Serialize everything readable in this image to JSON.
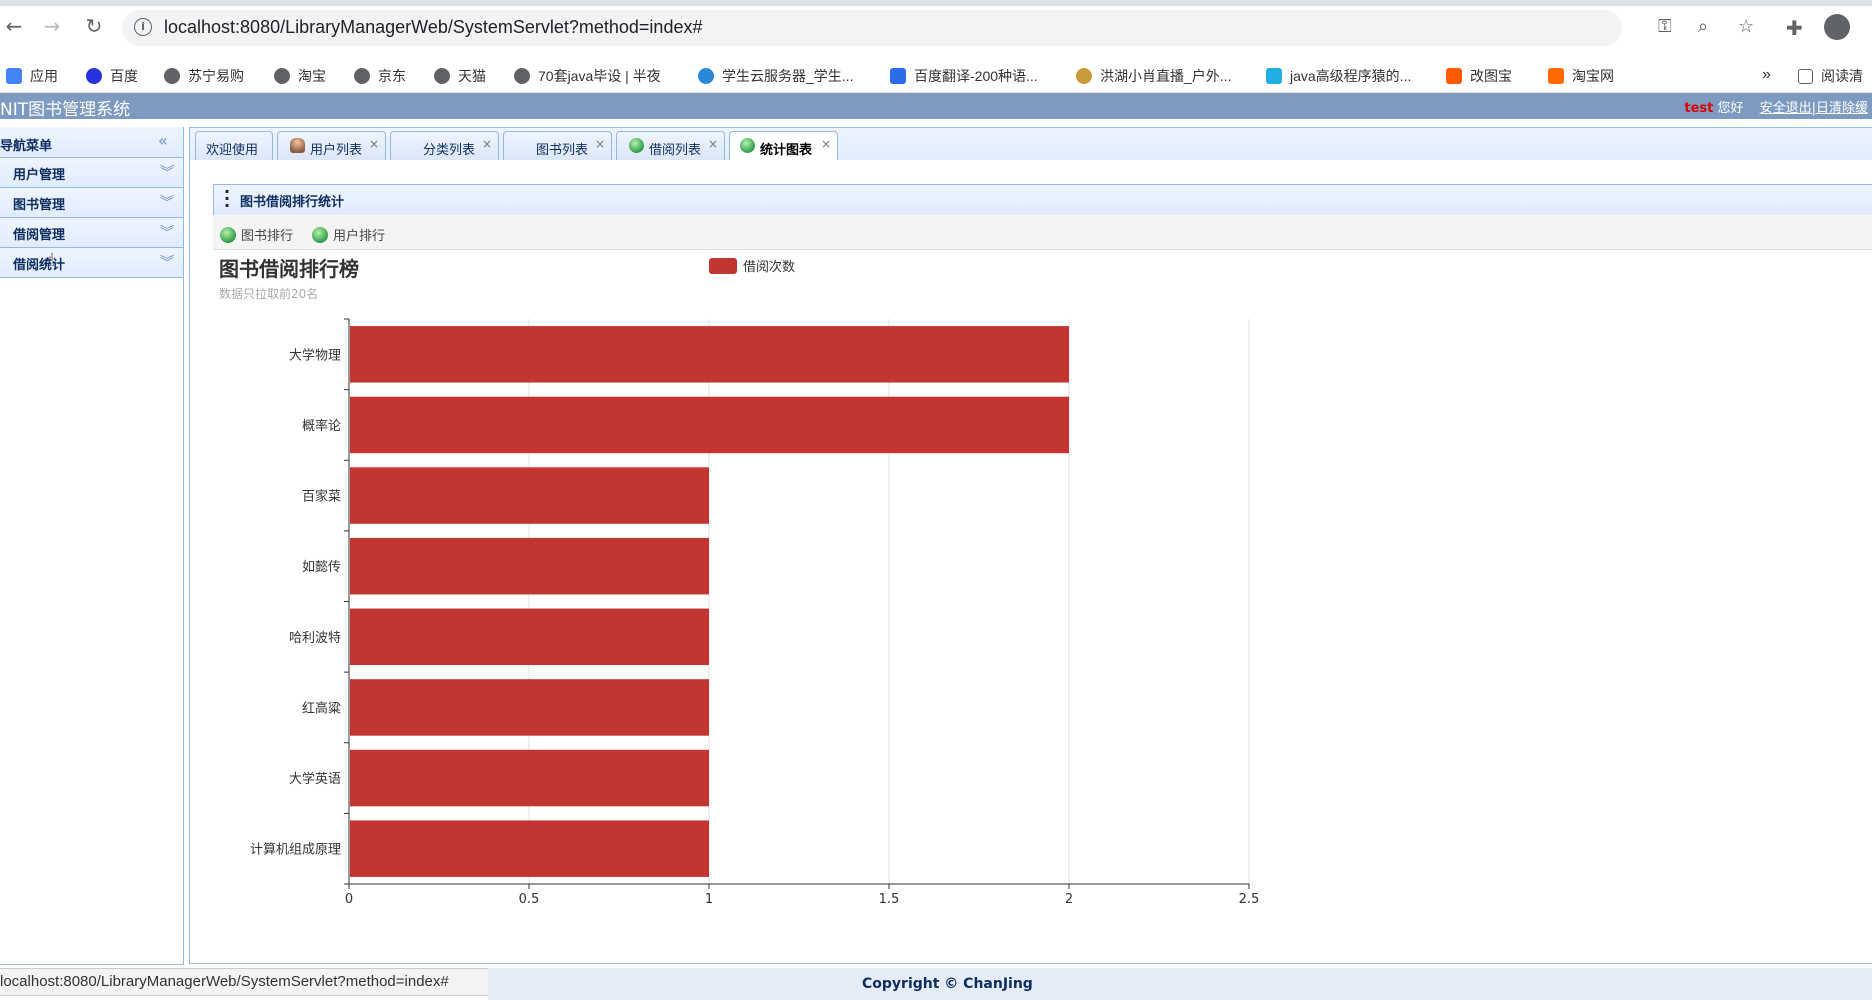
{
  "browser": {
    "url": "localhost:8080/LibraryManagerWeb/SystemServlet?method=index#",
    "bookmarks": [
      "应用",
      "百度",
      "苏宁易购",
      "淘宝",
      "京东",
      "天猫",
      "70套java毕设 | 半夜",
      "学生云服务器_学生...",
      "百度翻译-200种语...",
      "洪湖小肖直播_户外...",
      "java高级程序猿的...",
      "改图宝",
      "淘宝网"
    ],
    "bookmarks_more": "»",
    "reading_list": "阅读清"
  },
  "app": {
    "title": "NIT图书管理系统",
    "user": "test",
    "greeting": "您好",
    "logout": "安全退出|日清除缓"
  },
  "sidebar": {
    "title": "导航菜单",
    "items": [
      "用户管理",
      "图书管理",
      "借阅管理",
      "借阅统计"
    ]
  },
  "tabs": [
    {
      "label": "欢迎使用"
    },
    {
      "label": "用户列表"
    },
    {
      "label": "分类列表"
    },
    {
      "label": "图书列表"
    },
    {
      "label": "借阅列表"
    },
    {
      "label": "统计图表"
    }
  ],
  "panel": {
    "title": "图书借阅排行统计",
    "buttons": [
      "图书排行",
      "用户排行"
    ]
  },
  "chart_data": {
    "type": "bar",
    "orientation": "horizontal",
    "title": "图书借阅排行榜",
    "subtitle": "数据只拉取前20名",
    "categories": [
      "大学物理",
      "概率论",
      "百家菜",
      "如懿传",
      "哈利波特",
      "红高粱",
      "大学英语",
      "计算机组成原理"
    ],
    "series": [
      {
        "name": "借阅次数",
        "values": [
          2,
          2,
          1,
          1,
          1,
          1,
          1,
          1
        ],
        "color": "#c23531"
      }
    ],
    "xlim": [
      0,
      2.5
    ],
    "xticks": [
      "0",
      "0.5",
      "1",
      "1.5",
      "2",
      "2.5"
    ],
    "grid": true,
    "legend": "top-center"
  },
  "footer": {
    "status_url": "localhost:8080/LibraryManagerWeb/SystemServlet?method=index#",
    "copyright": "Copyright © ChanJing"
  }
}
